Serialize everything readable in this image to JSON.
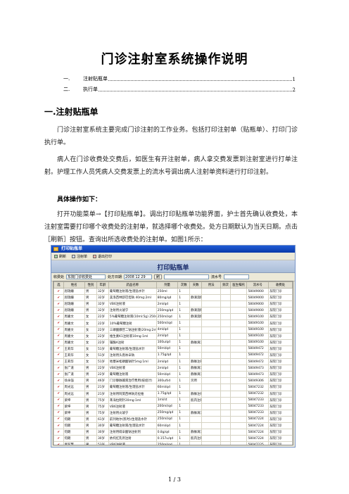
{
  "doc": {
    "title": "门诊注射室系统操作说明",
    "toc": [
      {
        "num": "一.",
        "text": "注射贴瓶单",
        "page": "1"
      },
      {
        "num": "二.",
        "text": "执行单",
        "page": "2"
      }
    ],
    "section1_heading": "一.注射贴瓶单",
    "para1": "门诊注射室系统主要完成门诊注射的工作业务。包括打印注射单（贴瓶单）、打印门诊执行单。",
    "para2": "病人在门诊收费处交费后，如医生有开注射单，病人拿交费发票到注射室进行打单注射。护理工作人员凭病人交费发票上的流水号调出病人注射单资料进行打印注射。",
    "subheading": "具体操作如下：",
    "para3": "打开功能菜单→【打印贴瓶单】。调出打印贴瓶单功能界面，护士首先确认收费处，本注射室需要打印哪个收费处的注射单，就选择哪个收费处。处方日期默认为当天日期。点击［刷新］按钮。查询出所选收费处的注射单。如图1所示：",
    "footer": "1 / 3"
  },
  "screenshot": {
    "window_title": "打印贴瓶单",
    "toolbar": [
      {
        "label": "刷新",
        "icon": "refresh-icon"
      },
      {
        "label": "注射单",
        "icon": "print-icon"
      },
      {
        "label": "退出打印",
        "icon": "exit-icon"
      }
    ],
    "banner": "打印贴瓶单",
    "filter": {
      "office_label": "收费处",
      "office_value": "东院门诊收费处",
      "date_label": "处方日期",
      "date_value": "2008 12 29",
      "search_label": "刷",
      "serial_label": "流水号"
    },
    "columns": [
      "选",
      "姓名",
      "性别",
      "年龄",
      "药品名称",
      "剂量",
      "次数",
      "天数",
      "用法",
      "频次",
      "医生嘱托",
      "流水号",
      "收费处"
    ],
    "rows": [
      [
        "✔",
        "屈瑞姗",
        "男",
        "32岁",
        "葡萄糖注射液/生理盐水针",
        "250ml",
        "1",
        "",
        "",
        "",
        "",
        "58049000",
        "东院门诊"
      ],
      [
        "✔",
        "屈瑞姗",
        "男",
        "32岁",
        "美洛西林舒巴坦钠 40mg:2ml",
        "80mg/qd",
        "1",
        "静滴溶解",
        "",
        "",
        "",
        "58049000",
        "东院门诊"
      ],
      [
        "✔",
        "屈瑞姗",
        "男",
        "32岁",
        "VB6注射液",
        "2ml/qd",
        "1",
        "",
        "",
        "",
        "",
        "58049000",
        "东院门诊"
      ],
      [
        "✔",
        "屈瑞姗",
        "男",
        "32岁",
        "注射用炎琥宁",
        "250mg/qd",
        "1",
        "静滴溶解",
        "",
        "",
        "",
        "58049000",
        "东院门诊"
      ],
      [
        "✔",
        "周嘉文",
        "女",
        "22岁",
        "5%葡萄糖注射液(10ml:5g) 250ml",
        "250ml/qd",
        "1",
        "静滴溶解",
        "",
        "",
        "",
        "58049100",
        "东院门诊"
      ],
      [
        "✔",
        "周嘉文",
        "女",
        "22岁",
        "10%葡萄糖注射",
        "500ml/qd",
        "1",
        "",
        "",
        "",
        "",
        "58049100",
        "东院门诊"
      ],
      [
        "✔",
        "周嘉文",
        "女",
        "22岁",
        "三磷酸腺苷二钠注射液(20mg:2ml)",
        "4ml/qd",
        "1",
        "",
        "",
        "",
        "",
        "58049100",
        "东院门诊"
      ],
      [
        "✔",
        "周嘉文",
        "女",
        "22岁",
        "维生素K1注射液10mg:1ml",
        "2ml/qd",
        "1",
        "",
        "",
        "",
        "",
        "58049100",
        "东院门诊"
      ],
      [
        "✔",
        "周嘉文",
        "女",
        "22岁",
        "辅酶A注射",
        "100u/qd",
        "1",
        "静脉滴注",
        "",
        "",
        "",
        "58049100",
        "东院门诊"
      ],
      [
        "✔",
        "王莉华",
        "女",
        "51岁",
        "葡萄糖注射液/生理盐水针",
        "50ml/qd",
        "1",
        "",
        "",
        "",
        "",
        "58049472",
        "东院门诊"
      ],
      [
        "✔",
        "王莉华",
        "女",
        "51岁",
        "注射用头孢呋辛钠",
        "1.75g/qd",
        "1",
        "",
        "",
        "",
        "",
        "58049472",
        "东院门诊"
      ],
      [
        "✔",
        "王莉华",
        "女",
        "51岁",
        "地塞米松磷酸钠针5mg:1ml",
        "2ml/qd",
        "1",
        "静脉注射",
        "",
        "",
        "",
        "58049472",
        "东院门诊"
      ],
      [
        "✔",
        "张广道",
        "男",
        "22岁",
        "VB6注射液",
        "2ml/qd",
        "1",
        "静脉滴注",
        "",
        "",
        "",
        "58049473",
        "东院门诊"
      ],
      [
        "✔",
        "张广道",
        "男",
        "22岁",
        "葡萄糖注射液",
        "50ml/qd",
        "1",
        "静脉滴注",
        "",
        "",
        "",
        "58049473",
        "东院门诊"
      ],
      [
        "✔",
        "徐永强",
        "男",
        "46岁",
        "门诊静脉输液治疗费用(按组计)",
        "300u/tid",
        "1",
        "另用",
        "",
        "",
        "",
        "58049306",
        "东院门诊"
      ],
      [
        "✔",
        "周光远",
        "男",
        "21岁",
        "葡萄糖注射液/生理盐水针",
        "60ml/qd",
        "1",
        "",
        "",
        "",
        "",
        "58047232",
        "东院门诊"
      ],
      [
        "✔",
        "周光远",
        "男",
        "21岁",
        "注射用阿莫西林钠克拉维",
        "1.75g/qd",
        "1",
        "静脉注射",
        "",
        "",
        "",
        "58047232",
        "东院门诊"
      ],
      [
        "✔",
        "梁坤",
        "男",
        "75岁",
        "苯海拉明针20mg:1ml",
        "1ml/st",
        "1",
        "肌内注射",
        "",
        "",
        "",
        "58047233",
        "东院门诊"
      ],
      [
        "✔",
        "梁坤",
        "男",
        "75岁",
        "VB6注射液",
        "200ml/qd",
        "1",
        "",
        "",
        "",
        "",
        "58047233",
        "东院门诊"
      ],
      [
        "✔",
        "梁坤",
        "男",
        "75岁",
        "注射用炎琥宁",
        "250mg/qd",
        "1",
        "静脉滴注",
        "",
        "",
        "",
        "58047233",
        "东院门诊"
      ],
      [
        "✔",
        "何朗",
        "男",
        "61岁",
        "前列地尔(凯时)/生理盐水针",
        "250ml/qd",
        "1",
        "",
        "",
        "",
        "",
        "58047224",
        "东院门诊"
      ],
      [
        "✔",
        "何朗",
        "男",
        "30岁",
        "葡萄糖注射液/生理盐水针",
        "60ml/qd",
        "1",
        "",
        "",
        "",
        "",
        "58047224",
        "东院门诊"
      ],
      [
        "✔",
        "何朗",
        "男",
        "30岁",
        "注射用硫辛酸钠注射剂",
        "0.8g/qd",
        "1",
        "静脉滴注",
        "",
        "",
        "",
        "58047224",
        "东院门诊"
      ],
      [
        "✔",
        "何朗",
        "男",
        "30岁",
        "依托红乳剂注射",
        "0.157u/qd",
        "1",
        "肌内注射",
        "",
        "",
        "",
        "58047224",
        "东院门诊"
      ],
      [
        "✔",
        "尹军慧",
        "男",
        "53岁",
        "VB6注射液",
        "250ml/qd",
        "1",
        "",
        "",
        "",
        "",
        "58047225",
        "东院门诊"
      ],
      [
        "✔",
        "尹军慧",
        "男",
        "53岁",
        "盐酸左氧氟沙星注射液 2ml:0.1g",
        "0.3g/qd",
        "1",
        "静脉滴注",
        "",
        "",
        "",
        "58047225",
        "东院门诊"
      ],
      [
        "✔",
        "尹军慧",
        "男",
        "53岁",
        "葡萄糖注射液/生理盐水针",
        "100ml/qd",
        "1",
        "",
        "",
        "",
        "",
        "58047225",
        "东院门诊"
      ],
      [
        "✔",
        "尹军慧",
        "男",
        "53岁",
        "盐酸曲吉沙林 8.1g:2ml",
        "2ml/qd",
        "1",
        "",
        "",
        "",
        "",
        "58047225",
        "东院门诊"
      ],
      [
        "✔",
        "尹军慧",
        "男",
        "53岁",
        "盐酸左旋去甲肾上腺素针10mg:1ml",
        "2ml/qd",
        "1",
        "静脉滴注",
        "",
        "",
        "",
        "58047225",
        "东院门诊"
      ],
      [
        "✔",
        "尹军慧",
        "男",
        "53岁",
        "前列地尔(凯时)/生理盐水针",
        "2ml/1d",
        "1",
        "静脉滴注",
        "",
        "",
        "",
        "58047225",
        "东院门诊"
      ]
    ]
  }
}
